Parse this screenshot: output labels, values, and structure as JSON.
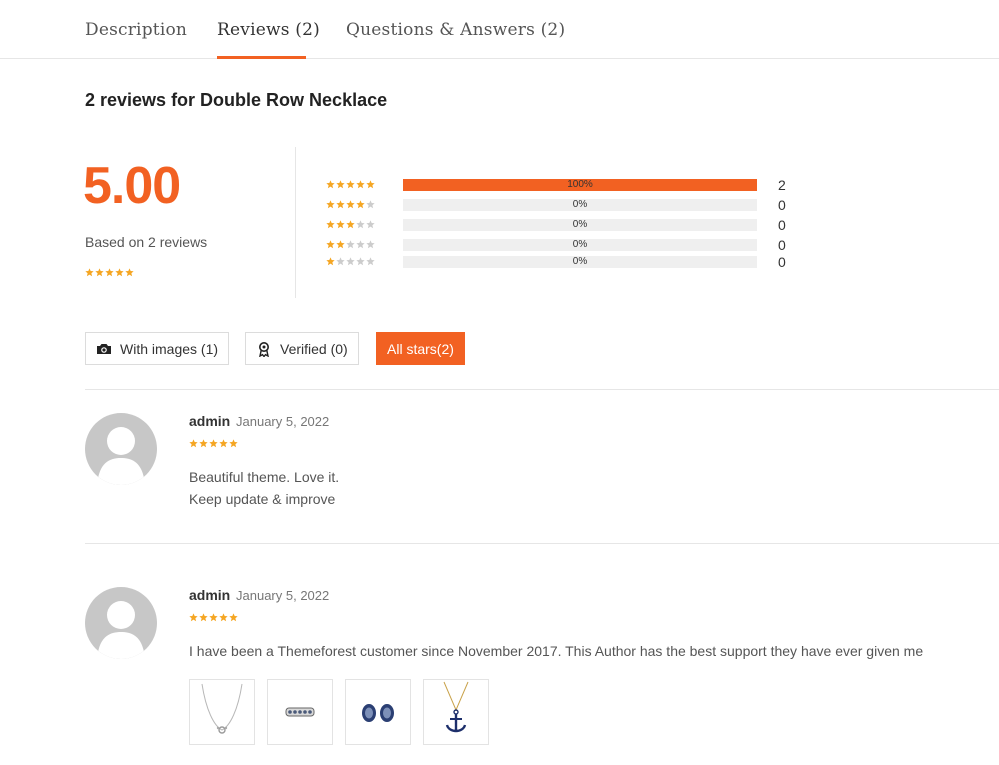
{
  "tabs": [
    {
      "label": "Description"
    },
    {
      "label": "Reviews (2)"
    },
    {
      "label": "Questions & Answers (2)"
    }
  ],
  "reviews_title": "2 reviews for Double Row Necklace",
  "summary": {
    "average": "5.00",
    "based_on": "Based on 2 reviews",
    "rating": 5
  },
  "breakdown": [
    {
      "stars": 5,
      "percent_label": "100%",
      "fraction": 1.0,
      "count": "2"
    },
    {
      "stars": 4,
      "percent_label": "0%",
      "fraction": 0.0,
      "count": "0"
    },
    {
      "stars": 3,
      "percent_label": "0%",
      "fraction": 0.0,
      "count": "0"
    },
    {
      "stars": 2,
      "percent_label": "0%",
      "fraction": 0.0,
      "count": "0"
    },
    {
      "stars": 1,
      "percent_label": "0%",
      "fraction": 0.0,
      "count": "0"
    }
  ],
  "filters": {
    "with_images": "With images (1)",
    "verified": "Verified (0)",
    "all_stars": "All stars(2)"
  },
  "reviews": [
    {
      "author": "admin",
      "date": "January 5, 2022",
      "rating": 5,
      "lines": [
        "Beautiful theme. Love it.",
        "Keep update & improve"
      ]
    },
    {
      "author": "admin",
      "date": "January 5, 2022",
      "rating": 5,
      "lines": [
        "I have been a Themeforest customer since November 2017. This Author has the best support they have ever given me"
      ],
      "images": [
        "necklace-thumbnail",
        "ring-thumbnail",
        "earrings-thumbnail",
        "anchor-pendant-thumbnail"
      ]
    }
  ],
  "colors": {
    "accent": "#f26122",
    "star": "#f5a623",
    "star_empty": "#cccccc"
  }
}
